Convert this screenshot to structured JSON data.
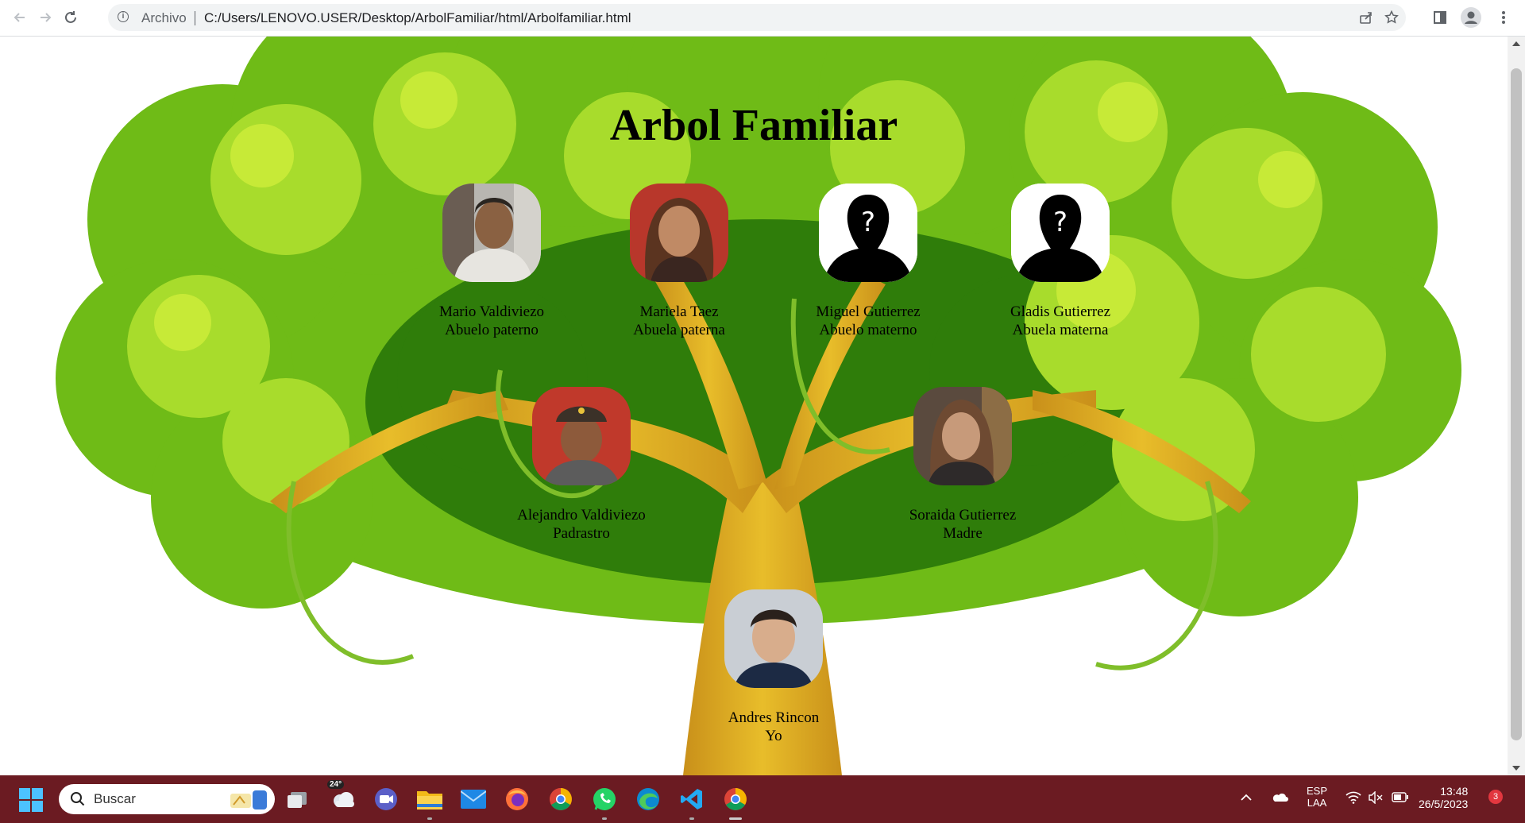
{
  "browser": {
    "site_label": "Archivo",
    "url": "C:/Users/LENOVO.USER/Desktop/ArbolFamiliar/html/Arbolfamiliar.html"
  },
  "page": {
    "title": "Arbol Familiar",
    "people": [
      {
        "name": "Mario Valdiviezo",
        "role": "Abuelo paterno",
        "photo": "photo"
      },
      {
        "name": "Mariela Taez",
        "role": "Abuela paterna",
        "photo": "photo"
      },
      {
        "name": "Miguel Gutierrez",
        "role": "Abuelo materno",
        "photo": "unknown-silhouette"
      },
      {
        "name": "Gladis Gutierrez",
        "role": "Abuela materna",
        "photo": "unknown-silhouette"
      },
      {
        "name": "Alejandro Valdiviezo",
        "role": "Padrastro",
        "photo": "photo"
      },
      {
        "name": "Soraida Gutierrez",
        "role": "Madre",
        "photo": "photo"
      },
      {
        "name": "Andres Rincon",
        "role": "Yo",
        "photo": "photo"
      }
    ]
  },
  "taskbar": {
    "search_placeholder": "Buscar",
    "weather_temp": "24°",
    "language_line1": "ESP",
    "language_line2": "LAA",
    "time": "13:48",
    "date": "26/5/2023",
    "notification_count": "3"
  },
  "colors": {
    "taskbar": "#6b1b22",
    "leaf_light": "#a9dd2a",
    "leaf_dark": "#4f9a0f",
    "trunk": "#d7a31c"
  }
}
